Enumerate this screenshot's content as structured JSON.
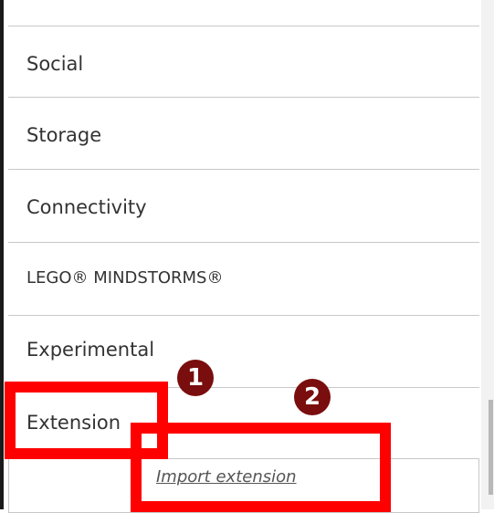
{
  "menu": {
    "items": [
      {
        "label": "Social"
      },
      {
        "label": "Storage"
      },
      {
        "label": "Connectivity"
      },
      {
        "label": "LEGO® MINDSTORMS®"
      },
      {
        "label": "Experimental"
      },
      {
        "label": "Extension"
      }
    ],
    "submenu": {
      "import_label": "Import extension"
    }
  },
  "annotations": {
    "badge_1": "1",
    "badge_2": "2",
    "highlight_color": "#ff0000",
    "badge_color": "#7a0d0d"
  }
}
